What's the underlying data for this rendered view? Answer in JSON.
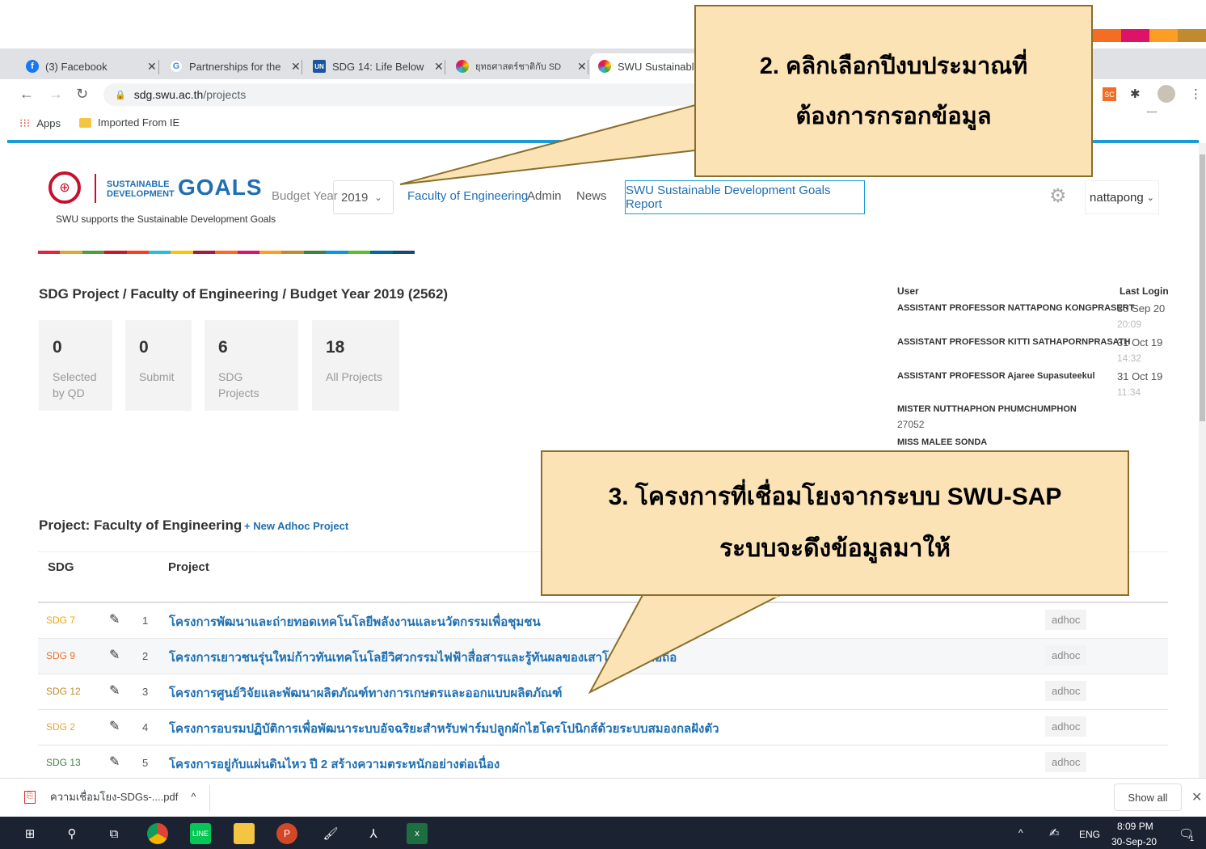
{
  "browser": {
    "tabs": [
      {
        "title": "(3) Facebook",
        "icon": "facebook-icon",
        "color": "#1877f2",
        "glyph": "f"
      },
      {
        "title": "Partnerships for the",
        "icon": "google-icon",
        "color": "#4285f4",
        "glyph": "G"
      },
      {
        "title": "SDG 14: Life Below",
        "icon": "un-icon",
        "color": "#1a55a0",
        "glyph": "UN"
      },
      {
        "title": "ยุทธศาสตร์ชาติกับ SD",
        "icon": "sdg-wheel-icon",
        "color": "#e8a33c",
        "glyph": "◎"
      },
      {
        "title": "SWU Sustainabl",
        "icon": "sdg-wheel-icon",
        "color": "#e8a33c",
        "glyph": "◎"
      }
    ],
    "url_host": "sdg.swu.ac.th",
    "url_path": "/projects",
    "bookmarks": [
      "Apps",
      "Imported From IE"
    ]
  },
  "site": {
    "logo_small_line1": "SUSTAINABLE",
    "logo_small_line2": "DEVELOPMENT",
    "logo_big": "GOALS",
    "tagline": "SWU supports the Sustainable Development Goals",
    "budget_label": "Budget Year",
    "budget_value": "2019",
    "nav": [
      "Faculty of Engineering",
      "Admin",
      "News"
    ],
    "report_button": "SWU Sustainable Development Goals Report",
    "user": "nattapong"
  },
  "breadcrumb": "SDG Project / Faculty of Engineering / Budget Year 2019 (2562)",
  "stats": [
    {
      "num": "0",
      "label": "Selected by QD"
    },
    {
      "num": "0",
      "label": "Submit"
    },
    {
      "num": "6",
      "label": "SDG Projects"
    },
    {
      "num": "18",
      "label": "All Projects"
    }
  ],
  "last_login": {
    "user_header": "User",
    "last_header": "Last Login",
    "entries": [
      {
        "name": "ASSISTANT PROFESSOR NATTAPONG KONGPRASERT",
        "date": "30 Sep 20",
        "time": "20:09"
      },
      {
        "name": "ASSISTANT PROFESSOR KITTI SATHAPORNPRASATH",
        "date": "31 Oct 19",
        "time": "14:32"
      },
      {
        "name": "ASSISTANT PROFESSOR Ajaree Supasuteekul",
        "date": "31 Oct 19",
        "time": "11:34"
      }
    ],
    "extra_name": "MISTER NUTTHAPHON PHUMCHUMPHON",
    "extra_id": "27052",
    "extra_name2": "MISS MALEE SONDA"
  },
  "projects": {
    "title": "Project: Faculty of Engineering",
    "new_link": "+ New Adhoc Project",
    "col_sdg": "SDG",
    "col_project": "Project",
    "rows": [
      {
        "sdg": "SDG 7",
        "sdg_color": "#f0a500",
        "idx": "1",
        "name": "โครงการพัฒนาและถ่ายทอดเทคโนโลยีพลังงานและนวัตกรรมเพื่อชุมชน",
        "badge": "adhoc"
      },
      {
        "sdg": "SDG 9",
        "sdg_color": "#f36d25",
        "idx": "2",
        "name": "โครงการเยาวชนรุ่นใหม่ก้าวทันเทคโนโลยีวิศวกรรมไฟฟ้าสื่อสารและรู้ทันผลของเสาโทรศัพท์มือถือ",
        "badge": "adhoc"
      },
      {
        "sdg": "SDG 12",
        "sdg_color": "#bf8b2e",
        "idx": "3",
        "name": "โครงการศูนย์วิจัยและพัฒนาผลิตภัณฑ์ทางการเกษตรและออกแบบผลิตภัณฑ์",
        "badge": "adhoc"
      },
      {
        "sdg": "SDG 2",
        "sdg_color": "#dda63a",
        "idx": "4",
        "name": "โครงการอบรมปฏิบัติการเพื่อพัฒนาระบบอัจฉริยะสำหรับฟาร์มปลูกผักไฮโดรโปนิกส์ด้วยระบบสมองกลฝังตัว",
        "badge": "adhoc"
      },
      {
        "sdg": "SDG 13",
        "sdg_color": "#3f7e44",
        "idx": "5",
        "name": "โครงการอยู่กับแผ่นดินไหว ปี 2 สร้างความตระหนักอย่างต่อเนื่อง",
        "badge": "adhoc"
      }
    ]
  },
  "callouts": {
    "c2_line1": "2. คลิกเลือกปีงบประมาณที่",
    "c2_line2": "ต้องการกรอกข้อมูล",
    "c3_line1": "3. โครงการที่เชื่อมโยงจากระบบ SWU-SAP",
    "c3_line2": "ระบบจะดึงข้อมูลมาให้"
  },
  "download": {
    "file": "ความเชื่อมโยง-SDGs-....pdf",
    "show_all": "Show all"
  },
  "taskbar": {
    "time": "8:09 PM",
    "date": "30-Sep-20",
    "lang": "ENG",
    "notif_count": "1"
  },
  "colors": {
    "sdg_strip": [
      "#e5243b",
      "#dda63a",
      "#4c9f38",
      "#c5192d",
      "#ff3a21",
      "#26bde2",
      "#fcc30b",
      "#a21942",
      "#fd6925",
      "#dd1367",
      "#fd9d24",
      "#bf8b2e",
      "#3f7e44",
      "#0a97d9",
      "#56c02b",
      "#00689d",
      "#19486a"
    ]
  }
}
